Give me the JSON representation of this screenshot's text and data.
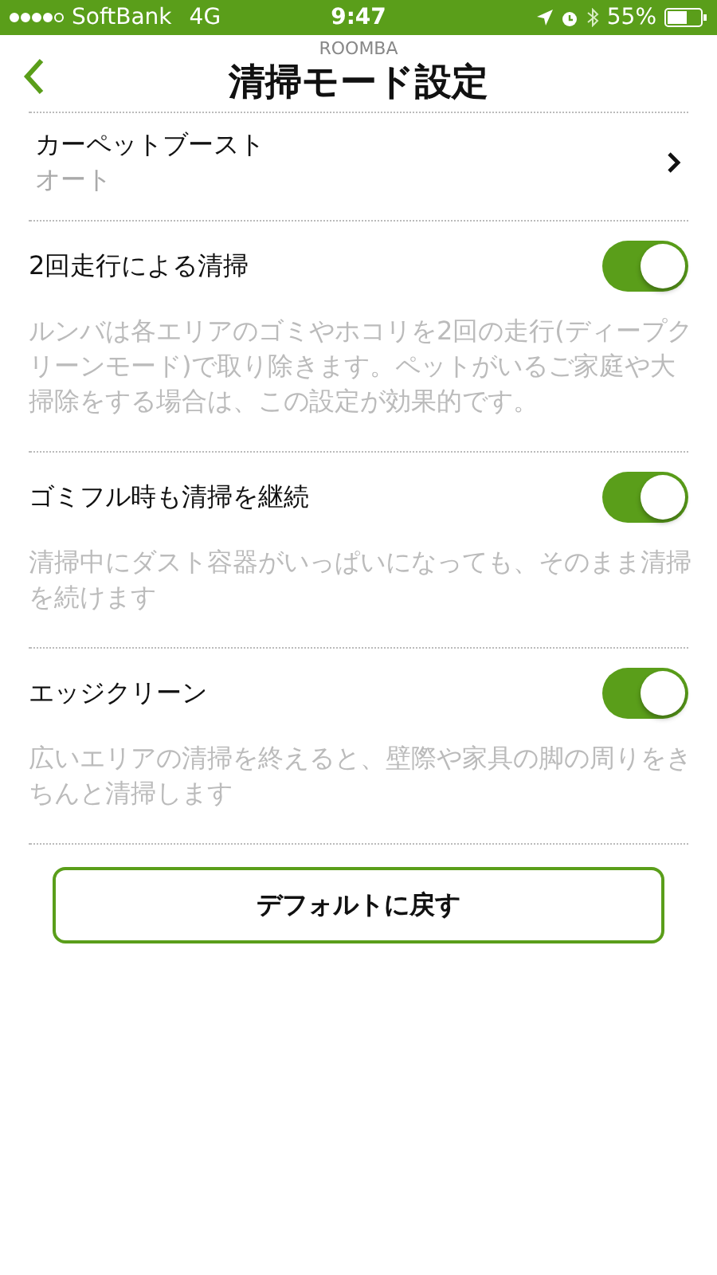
{
  "status_bar": {
    "carrier": "SoftBank",
    "network": "4G",
    "time": "9:47",
    "battery": "55%",
    "signal_dots": [
      {
        "on": true
      },
      {
        "on": true
      },
      {
        "on": true
      },
      {
        "on": true
      },
      {
        "on": false
      }
    ]
  },
  "header": {
    "subtitle": "ROOMBA",
    "title": "清掃モード設定"
  },
  "settings": [
    {
      "kind": "link",
      "label": "カーペットブースト",
      "value": "オート"
    },
    {
      "kind": "toggle",
      "label": "2回走行による清掃",
      "on": true,
      "description": "ルンバは各エリアのゴミやホコリを2回の走行(ディープクリーンモード)で取り除きます。ペットがいるご家庭や大掃除をする場合は、この設定が効果的です。"
    },
    {
      "kind": "toggle",
      "label": "ゴミフル時も清掃を継続",
      "on": true,
      "description": "清掃中にダスト容器がいっぱいになっても、そのまま清掃を続けます"
    },
    {
      "kind": "toggle",
      "label": "エッジクリーン",
      "on": true,
      "description": "広いエリアの清掃を終えると、壁際や家具の脚の周りをきちんと清掃します"
    }
  ],
  "reset_button": "デフォルトに戻す"
}
